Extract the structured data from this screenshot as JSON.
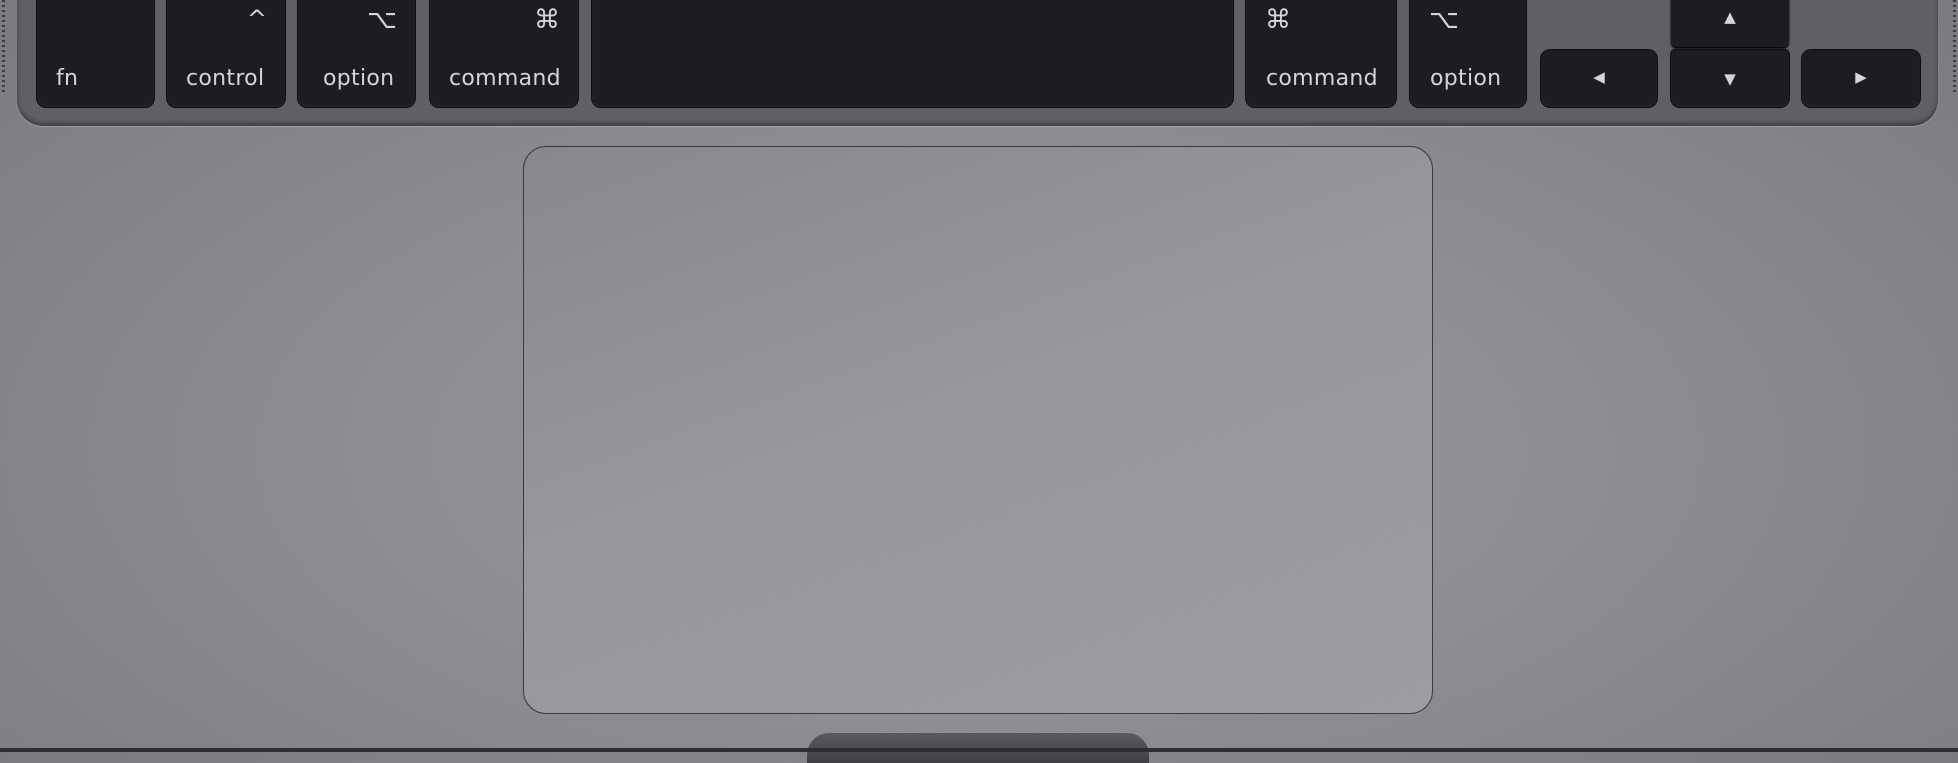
{
  "keyboard": {
    "keys": [
      {
        "id": "fn",
        "label": "fn",
        "symbol": ""
      },
      {
        "id": "control-left",
        "label": "control",
        "symbol": "^"
      },
      {
        "id": "option-left",
        "label": "option",
        "symbol": "⌥"
      },
      {
        "id": "command-left",
        "label": "command",
        "symbol": "⌘"
      },
      {
        "id": "space",
        "label": "",
        "symbol": ""
      },
      {
        "id": "command-right",
        "label": "command",
        "symbol": "⌘"
      },
      {
        "id": "option-right",
        "label": "option",
        "symbol": "⌥"
      }
    ],
    "arrows": {
      "left": "◀",
      "up": "▲",
      "down": "▼",
      "right": "▶"
    }
  },
  "colors": {
    "key": "#1c1d20",
    "body": "#8c8d91",
    "key_text": "#d4d5d8"
  }
}
